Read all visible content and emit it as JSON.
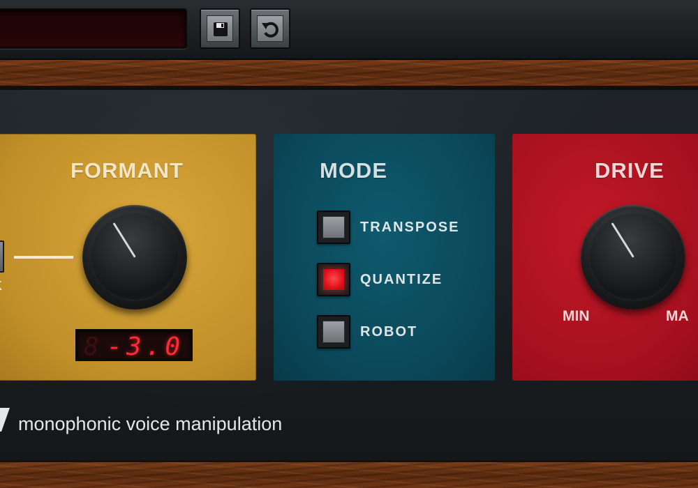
{
  "toolbar": {
    "preset_value": "",
    "save_icon": "save-icon",
    "undo_icon": "undo-icon"
  },
  "formant": {
    "title": "FORMANT",
    "link_label": "K",
    "value_display": "-3.0",
    "knob_level": 0.15
  },
  "mode": {
    "title": "MODE",
    "options": [
      {
        "label": "TRANSPOSE",
        "active": false
      },
      {
        "label": "QUANTIZE",
        "active": true
      },
      {
        "label": "ROBOT",
        "active": false
      }
    ]
  },
  "drive": {
    "title": "DRIVE",
    "min_label": "MIN",
    "max_label": "MA",
    "knob_level": 0.15
  },
  "footer": {
    "tagline": "monophonic voice manipulation"
  },
  "colors": {
    "formant_panel": "#c08f28",
    "mode_panel": "#0a4758",
    "drive_panel": "#a5101e",
    "led_red": "#ff2a3a",
    "active_button": "#e0121c"
  }
}
